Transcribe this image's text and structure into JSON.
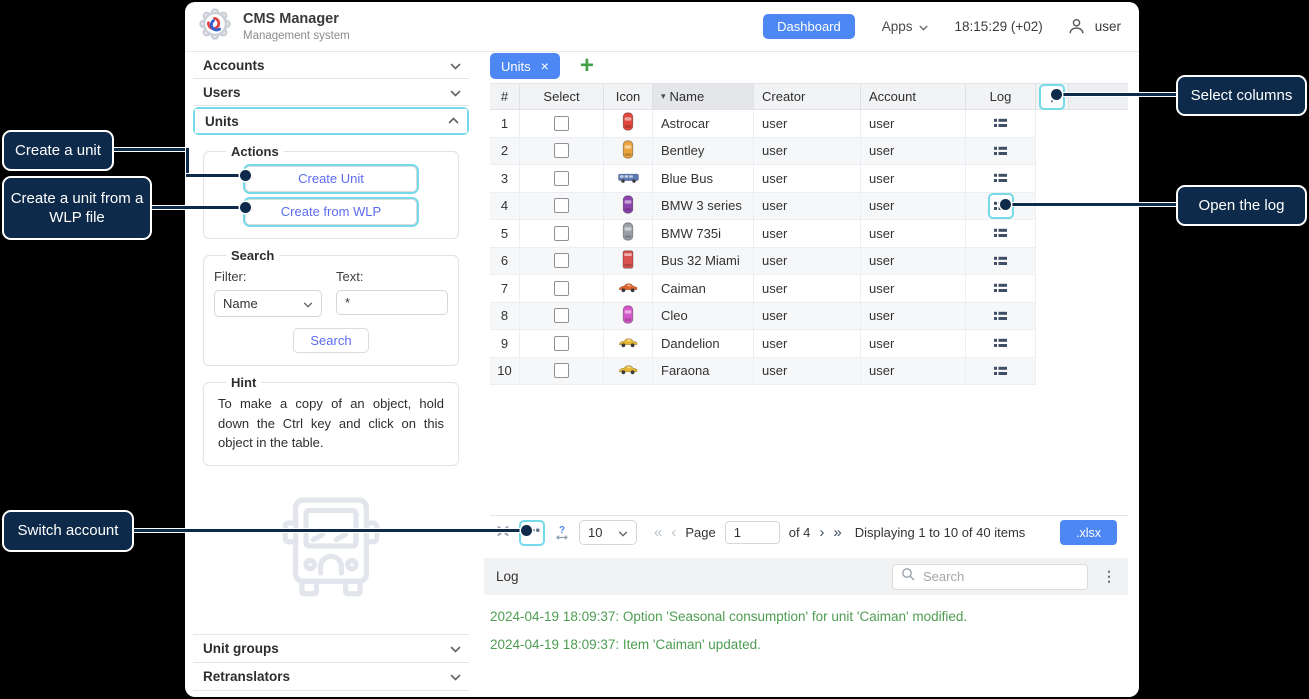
{
  "colors": {
    "accent_blue": "#4d87f3",
    "highlight_cyan": "#74d9e8",
    "callout_navy": "#0e2a4a",
    "log_green": "#4e9d52",
    "plus_green": "#3fa047"
  },
  "icons": {
    "kebab": "⋮",
    "sort_desc": "▾",
    "tab_close": "×",
    "add_tab": "+",
    "first": "«",
    "prev": "‹",
    "next": "›",
    "last": "»"
  },
  "header": {
    "app_title": "CMS Manager",
    "app_subtitle": "Management system",
    "dashboard_button": "Dashboard",
    "apps_label": "Apps",
    "time": "18:15:29 (+02)",
    "username": "user"
  },
  "sidebar": {
    "sections": [
      {
        "label": "Accounts",
        "state": "collapsed"
      },
      {
        "label": "Users",
        "state": "collapsed"
      },
      {
        "label": "Units",
        "state": "expanded"
      },
      {
        "label": "Unit groups",
        "state": "collapsed"
      },
      {
        "label": "Retranslators",
        "state": "collapsed"
      }
    ],
    "actions": {
      "legend": "Actions",
      "create_unit_button": "Create Unit",
      "create_wlp_button": "Create from WLP"
    },
    "search": {
      "legend": "Search",
      "filter_label": "Filter:",
      "filter_value": "Name",
      "text_label": "Text:",
      "text_value": "*",
      "search_button": "Search"
    },
    "hint": {
      "legend": "Hint",
      "text": "To make a copy of an object, hold down the Ctrl key and click on this object in the table."
    }
  },
  "tabs": {
    "active_label": "Units"
  },
  "table": {
    "columns": {
      "num": "#",
      "select": "Select",
      "icon": "Icon",
      "name": "Name",
      "creator": "Creator",
      "account": "Account",
      "log": "Log"
    },
    "sorted_column": "Name",
    "rows": [
      {
        "num": "1",
        "name": "Astrocar",
        "creator": "user",
        "account": "user",
        "icon": "car-top",
        "color": "#e0483d"
      },
      {
        "num": "2",
        "name": "Bentley",
        "creator": "user",
        "account": "user",
        "icon": "car-top",
        "color": "#e8a33d"
      },
      {
        "num": "3",
        "name": "Blue Bus",
        "creator": "user",
        "account": "user",
        "icon": "bus-side",
        "color": "#5b79b3"
      },
      {
        "num": "4",
        "name": "BMW 3 series",
        "creator": "user",
        "account": "user",
        "icon": "car-top",
        "color": "#8e44ad",
        "log_highlighted": true
      },
      {
        "num": "5",
        "name": "BMW 735i",
        "creator": "user",
        "account": "user",
        "icon": "car-top",
        "color": "#9aa0a8"
      },
      {
        "num": "6",
        "name": "Bus 32 Miami",
        "creator": "user",
        "account": "user",
        "icon": "bus-top",
        "color": "#d9534f"
      },
      {
        "num": "7",
        "name": "Caiman",
        "creator": "user",
        "account": "user",
        "icon": "car-side",
        "color": "#e2622b"
      },
      {
        "num": "8",
        "name": "Cleo",
        "creator": "user",
        "account": "user",
        "icon": "car-top",
        "color": "#d657c8"
      },
      {
        "num": "9",
        "name": "Dandelion",
        "creator": "user",
        "account": "user",
        "icon": "car-side",
        "color": "#e8b832"
      },
      {
        "num": "10",
        "name": "Faraona",
        "creator": "user",
        "account": "user",
        "icon": "car-side",
        "color": "#e5b62e"
      }
    ]
  },
  "pagination": {
    "page_size": "10",
    "page_label": "Page",
    "page_value": "1",
    "of_label": "of 4",
    "summary": "Displaying 1 to 10 of 40 items",
    "export_button": ".xlsx"
  },
  "log_panel": {
    "title": "Log",
    "search_placeholder": "Search",
    "entries": [
      "2024-04-19 18:09:37: Option 'Seasonal consumption' for unit 'Caiman' modified.",
      "2024-04-19 18:09:37: Item 'Caiman' updated."
    ]
  },
  "callouts": {
    "create_unit": "Create a unit",
    "create_wlp": "Create a unit from a WLP file",
    "switch_account": "Switch account",
    "select_columns": "Select columns",
    "open_log": "Open the log"
  }
}
